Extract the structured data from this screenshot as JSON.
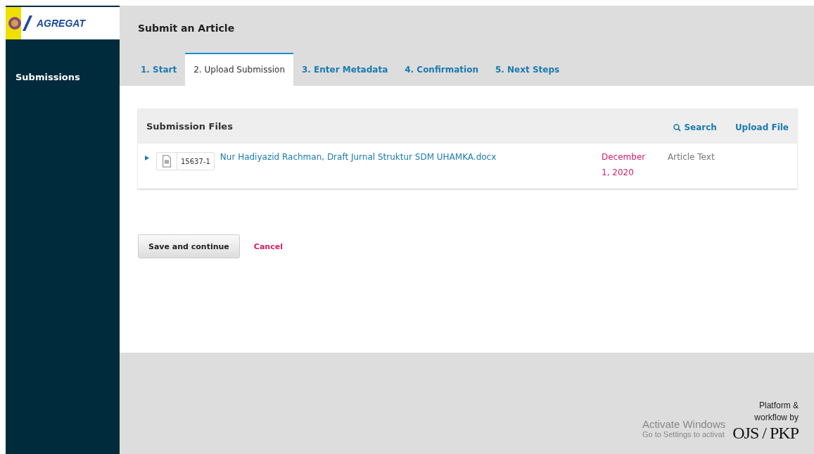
{
  "logo": {
    "text": "AGREGAT"
  },
  "sidebar": {
    "items": [
      {
        "label": "Submissions",
        "selected": true
      }
    ]
  },
  "header": {
    "title": "Submit an Article"
  },
  "tabs": [
    {
      "label": "1. Start",
      "selected": false
    },
    {
      "label": "2. Upload Submission",
      "selected": true
    },
    {
      "label": "3. Enter Metadata",
      "selected": false
    },
    {
      "label": "4. Confirmation",
      "selected": false
    },
    {
      "label": "5. Next Steps",
      "selected": false
    }
  ],
  "files_panel": {
    "title": "Submission Files",
    "actions": [
      "Search",
      "Upload File"
    ],
    "rows": [
      {
        "expanded": false,
        "id": "15637-1",
        "name": "Nur Hadiyazid Rachman, Draft Jurnal Struktur SDM UHAMKA.docx",
        "date": "December 1, 2020",
        "type": "Article Text"
      }
    ]
  },
  "buttons": {
    "save": "Save and continue",
    "cancel": "Cancel"
  },
  "footer": {
    "brand_caption": "Platform & workflow by",
    "brand": "OJS / PKP"
  },
  "os_notice": {
    "title": "Activate Windows",
    "text": "Go to Settings to activat"
  }
}
